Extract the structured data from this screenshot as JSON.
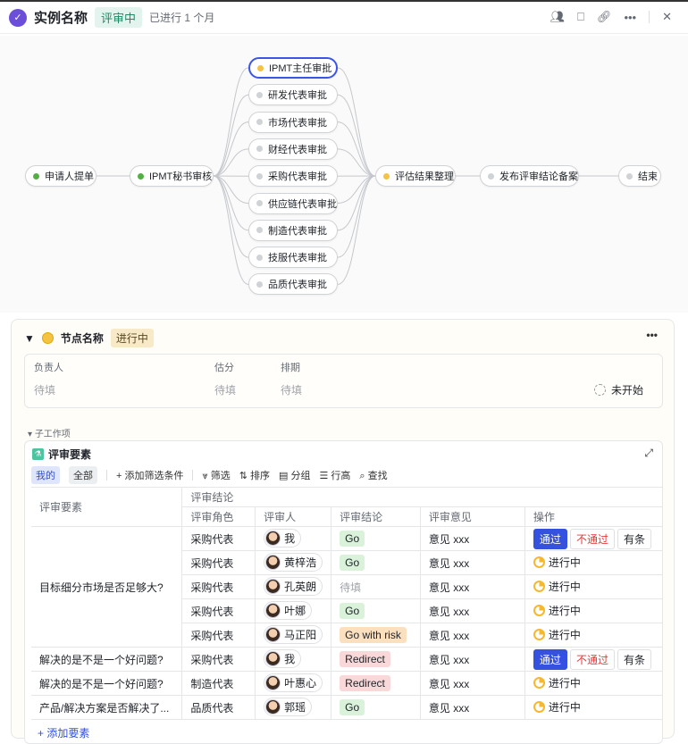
{
  "header": {
    "title": "实例名称",
    "status": "评审中",
    "elapsed": "已进行 1 个月"
  },
  "flow": {
    "start": {
      "label": "申请人提单",
      "status": "done"
    },
    "secretary": {
      "label": "IPMT秘书审核",
      "status": "done"
    },
    "parallel": [
      {
        "label": "IPMT主任审批",
        "status": "active"
      },
      {
        "label": "研发代表审批",
        "status": "pending"
      },
      {
        "label": "市场代表审批",
        "status": "pending"
      },
      {
        "label": "财经代表审批",
        "status": "pending"
      },
      {
        "label": "采购代表审批",
        "status": "pending"
      },
      {
        "label": "供应链代表审批",
        "status": "pending"
      },
      {
        "label": "制造代表审批",
        "status": "pending"
      },
      {
        "label": "技服代表审批",
        "status": "pending"
      },
      {
        "label": "品质代表审批",
        "status": "pending"
      }
    ],
    "evaluate": {
      "label": "评估结果整理",
      "status": "active"
    },
    "publish": {
      "label": "发布评审结论备案",
      "status": "pending"
    },
    "end": {
      "label": "结束",
      "status": "pending"
    }
  },
  "colors": {
    "done": "#52b043",
    "active": "#f5c342",
    "pending": "#d0d3d6",
    "accent": "#3451e0"
  },
  "node": {
    "name": "节点名称",
    "status": "进行中",
    "owner_label": "负责人",
    "owner": "待填",
    "estimate_label": "估分",
    "estimate": "待填",
    "schedule_label": "排期",
    "schedule": "待填",
    "state": "未开始"
  },
  "subwork": {
    "label": "子工作项",
    "card_title": "评审要素",
    "toolbar": {
      "mine": "我的",
      "all": "全部",
      "add_filter": "+ 添加筛选条件",
      "filter": "筛选",
      "sort": "排序",
      "group": "分组",
      "row_height": "行高",
      "find": "查找"
    },
    "columns": {
      "element": "评审要素",
      "group": "评审结论",
      "role": "评审角色",
      "reviewer": "评审人",
      "conclusion": "评审结论",
      "opinion": "评审意见",
      "action": "操作"
    },
    "rows": [
      {
        "element": "目标细分市场是否足够大?",
        "role": "采购代表",
        "reviewer": "我",
        "conclusion": "Go",
        "ctype": "go",
        "opinion": "意见 xxx",
        "action": "buttons"
      },
      {
        "element": "",
        "role": "采购代表",
        "reviewer": "黄梓浩",
        "conclusion": "Go",
        "ctype": "go",
        "opinion": "意见 xxx",
        "action": "进行中"
      },
      {
        "element": "",
        "role": "采购代表",
        "reviewer": "孔英朗",
        "conclusion": "待填",
        "ctype": "pend",
        "opinion": "意见 xxx",
        "action": "进行中"
      },
      {
        "element": "",
        "role": "采购代表",
        "reviewer": "叶娜",
        "conclusion": "Go",
        "ctype": "go",
        "opinion": "意见 xxx",
        "action": "进行中"
      },
      {
        "element": "",
        "role": "采购代表",
        "reviewer": "马正阳",
        "conclusion": "Go with risk",
        "ctype": "risk",
        "opinion": "意见 xxx",
        "action": "进行中"
      },
      {
        "element": "解决的是不是一个好问题?",
        "role": "采购代表",
        "reviewer": "我",
        "conclusion": "Redirect",
        "ctype": "redir",
        "opinion": "意见 xxx",
        "action": "buttons"
      },
      {
        "element": "解决的是不是一个好问题?",
        "role": "制造代表",
        "reviewer": "叶惠心",
        "conclusion": "Redirect",
        "ctype": "redir",
        "opinion": "意见 xxx",
        "action": "进行中"
      },
      {
        "element": "产品/解决方案是否解决了...",
        "role": "品质代表",
        "reviewer": "郭瑶",
        "conclusion": "Go",
        "ctype": "go",
        "opinion": "意见 xxx",
        "action": "进行中"
      }
    ],
    "buttons": {
      "pass": "通过",
      "fail": "不通过",
      "conditional": "有条"
    },
    "add_element": "+ 添加要素"
  }
}
